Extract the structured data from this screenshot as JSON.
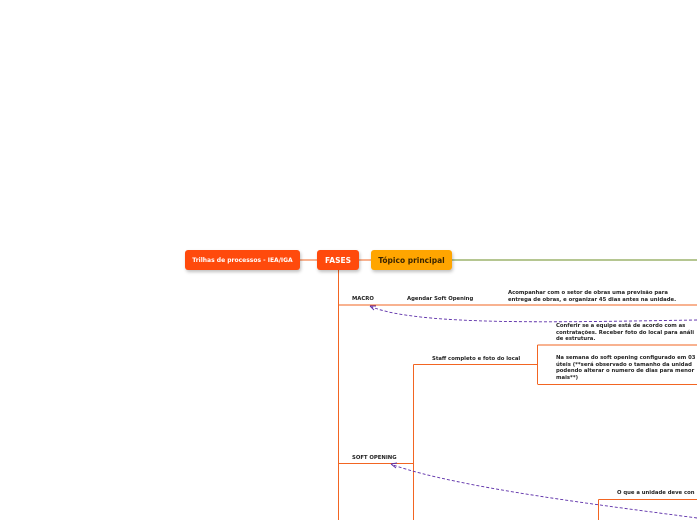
{
  "map": {
    "root": "Trilhas de processos - IEA/IGA",
    "main": "FASES",
    "topic": "Tópico principal",
    "phases": [
      {
        "label": "MACRO"
      },
      {
        "label": "SOFT OPENING"
      }
    ],
    "tasks": [
      {
        "label": "Agendar Soft Opening"
      },
      {
        "label": "Staff completo e foto do local"
      }
    ],
    "notes": [
      {
        "text": "Acompanhar com o setor de obras uma previsão para\nentrega de obras, e organizar 45 dias antes na unidade."
      },
      {
        "text": "Conferir se a equipe está de acordo com as\ncontratações. Receber foto do local para análi\nde estrutura."
      },
      {
        "text": "Na semana do soft opening configurado em 03\núteis (**será observado o tamanho da unidad\npodendo alterar o numero de dias para menor\nmais**)"
      },
      {
        "text": "O que a unidade deve con"
      }
    ]
  },
  "colors": {
    "branch": "#f26522",
    "root_fill": "#ff4a0c",
    "topic_fill": "#ffa500",
    "topic_line": "#6b8e23",
    "relation": "#5b2da8"
  }
}
